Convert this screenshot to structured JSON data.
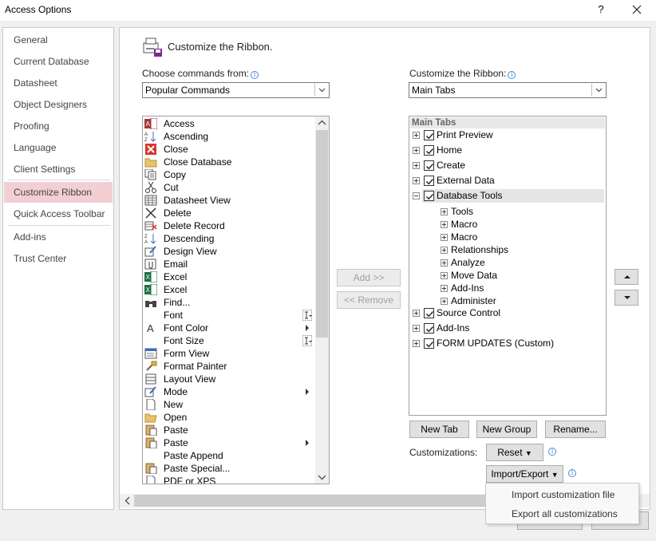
{
  "window": {
    "title": "Access Options",
    "help": "?",
    "close": "✕"
  },
  "nav": {
    "items": [
      "General",
      "Current Database",
      "Datasheet",
      "Object Designers",
      "Proofing",
      "Language",
      "Client Settings",
      "Customize Ribbon",
      "Quick Access Toolbar",
      "Add-ins",
      "Trust Center"
    ],
    "selected": "Customize Ribbon"
  },
  "main": {
    "header": "Customize the Ribbon.",
    "choose_label": "Choose commands from:",
    "choose_value": "Popular Commands",
    "customize_label": "Customize the Ribbon:",
    "customize_value": "Main Tabs",
    "commands": [
      "Access",
      "Ascending",
      "Close",
      "Close Database",
      "Copy",
      "Cut",
      "Datasheet View",
      "Delete",
      "Delete Record",
      "Descending",
      "Design View",
      "Email",
      "Excel",
      "Excel",
      "Find...",
      "Font",
      "Font Color",
      "Font Size",
      "Form View",
      "Format Painter",
      "Layout View",
      "Mode",
      "New",
      "Open",
      "Paste",
      "Paste",
      "Paste Append",
      "Paste Special...",
      "PDF or XPS"
    ],
    "add_button": "Add >>",
    "remove_button": "<< Remove",
    "tree_header": "Main Tabs",
    "tabs": {
      "print_preview": "Print Preview",
      "home": "Home",
      "create": "Create",
      "external_data": "External Data",
      "database_tools": "Database Tools",
      "groups": [
        "Tools",
        "Macro",
        "Macro",
        "Relationships",
        "Analyze",
        "Move Data",
        "Add-Ins",
        "Administer"
      ],
      "source_control": "Source Control",
      "add_ins": "Add-Ins",
      "form_updates": "FORM UPDATES (Custom)"
    },
    "new_tab": "New Tab",
    "new_group": "New Group",
    "rename": "Rename...",
    "customizations_label": "Customizations:",
    "reset": "Reset",
    "import_export": "Import/Export",
    "popup": [
      "Import customization file",
      "Export all customizations"
    ]
  },
  "colors": {
    "selected_nav": "#f2cfd3",
    "info_blue": "#4a8ad4"
  }
}
